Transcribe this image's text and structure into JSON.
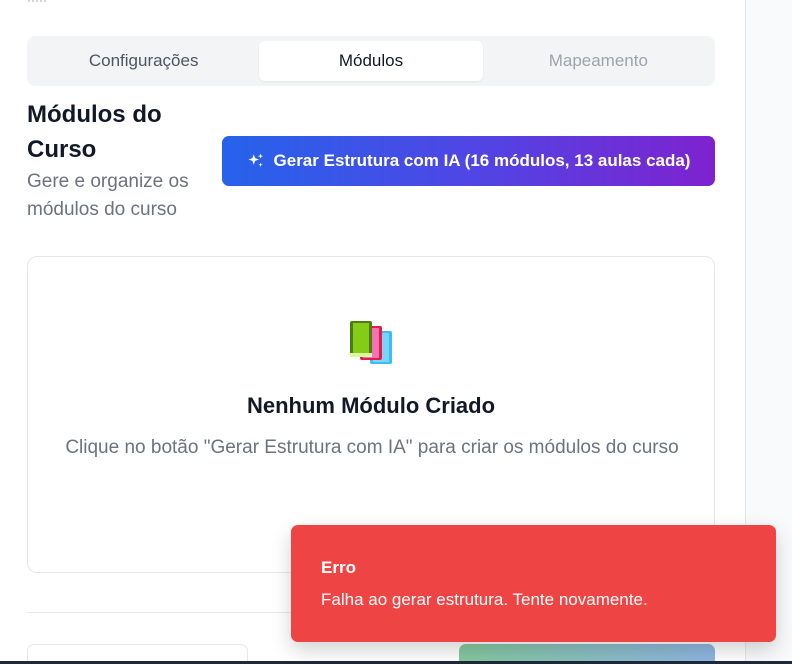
{
  "tabs": [
    {
      "label": "Configurações",
      "state": "inactive"
    },
    {
      "label": "Módulos",
      "state": "active"
    },
    {
      "label": "Mapeamento",
      "state": "disabled"
    }
  ],
  "section": {
    "title": "Módulos do Curso",
    "subtitle": "Gere e organize os módulos do curso"
  },
  "generate_button": {
    "icon": "sparkles-icon",
    "label": "Gerar Estrutura com IA (16 módulos, 13 aulas cada)"
  },
  "empty_state": {
    "icon": "books-icon",
    "title": "Nenhum Módulo Criado",
    "description": "Clique no botão \"Gerar Estrutura com IA\" para criar os módulos do curso"
  },
  "toast": {
    "title": "Erro",
    "message": "Falha ao gerar estrutura. Tente novamente."
  },
  "colors": {
    "accent_start": "#2563eb",
    "accent_end": "#7e22ce",
    "error": "#ef4444"
  }
}
